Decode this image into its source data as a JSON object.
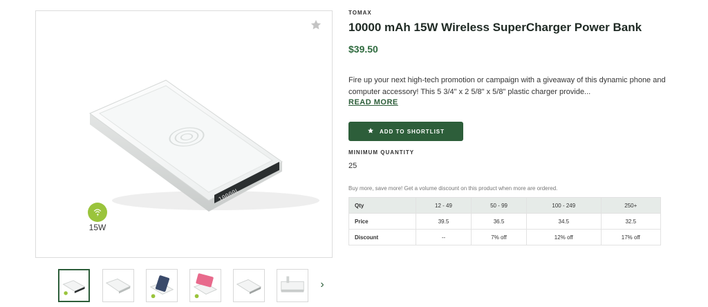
{
  "product": {
    "brand": "TOMAX",
    "title": "10000 mAh 15W Wireless SuperCharger Power Bank",
    "price": "$39.50",
    "description": "Fire up your next high-tech promotion or campaign with a giveaway of this dynamic phone and computer accessory! This 5 3/4\" x 2 5/8\" x 5/8\" plastic charger provide...",
    "read_more": "READ MORE",
    "shortlist_button": "ADD TO SHORTLIST",
    "min_qty_label": "MINIMUM QUANTITY",
    "min_qty_value": "25",
    "volume_note": "Buy more, save more! Get a volume discount on this product when more are ordered."
  },
  "gallery": {
    "badge_label": "15W",
    "product_print": "10000L",
    "thumbnail_count": 6,
    "active_thumbnail": 0
  },
  "pricing": {
    "headers": [
      "Qty",
      "12 - 49",
      "50 - 99",
      "100 - 249",
      "250+"
    ],
    "rows": [
      [
        "Price",
        "39.5",
        "36.5",
        "34.5",
        "32.5"
      ],
      [
        "Discount",
        "--",
        "7% off",
        "12% off",
        "17% off"
      ]
    ]
  },
  "colors": {
    "accent": "#2d5e3a",
    "price": "#2e6a3e",
    "badge": "#9ac43c",
    "table_header": "#e6ebe8"
  },
  "icons": {
    "favorite": "star-icon",
    "shortlist": "star-icon",
    "badge": "wireless-charging-icon",
    "next": "chevron-right-icon"
  }
}
